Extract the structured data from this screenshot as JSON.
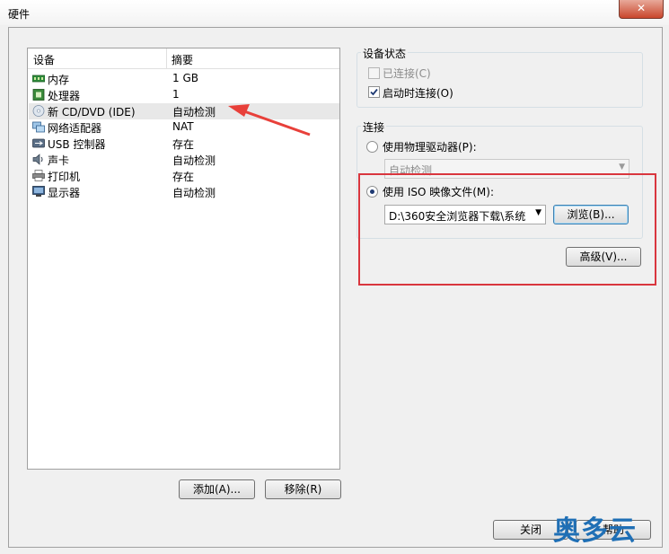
{
  "window": {
    "title": "硬件",
    "close_glyph": "✕"
  },
  "device_list": {
    "columns": [
      "设备",
      "摘要"
    ],
    "rows": [
      {
        "name": "内存",
        "summary": "1 GB",
        "icon": "memory-icon"
      },
      {
        "name": "处理器",
        "summary": "1",
        "icon": "cpu-icon"
      },
      {
        "name": "新 CD/DVD (IDE)",
        "summary": "自动检测",
        "icon": "cd-dvd-icon",
        "selected": true
      },
      {
        "name": "网络适配器",
        "summary": "NAT",
        "icon": "network-adapter-icon"
      },
      {
        "name": "USB 控制器",
        "summary": "存在",
        "icon": "usb-icon"
      },
      {
        "name": "声卡",
        "summary": "自动检测",
        "icon": "sound-card-icon"
      },
      {
        "name": "打印机",
        "summary": "存在",
        "icon": "printer-icon"
      },
      {
        "name": "显示器",
        "summary": "自动检测",
        "icon": "monitor-icon"
      }
    ],
    "add_button": "添加(A)...",
    "remove_button": "移除(R)"
  },
  "device_status": {
    "title": "设备状态",
    "connected_label": "已连接(C)",
    "connected_checked": false,
    "connected_enabled": false,
    "connect_on_start_label": "启动时连接(O)",
    "connect_on_start_checked": true
  },
  "connection": {
    "title": "连接",
    "physical_label": "使用物理驱动器(P):",
    "physical_value": "自动检测",
    "iso_label": "使用 ISO 映像文件(M):",
    "iso_value": "D:\\360安全浏览器下载\\系统",
    "browse_button": "浏览(B)...",
    "advanced_button": "高级(V)..."
  },
  "footer": {
    "close_button": "关闭",
    "help_button": "帮助"
  },
  "watermark": "奥多云",
  "colors": {
    "highlight_box": "#d9363e",
    "arrow": "#e8403a",
    "watermark": "#1f6fb5"
  }
}
